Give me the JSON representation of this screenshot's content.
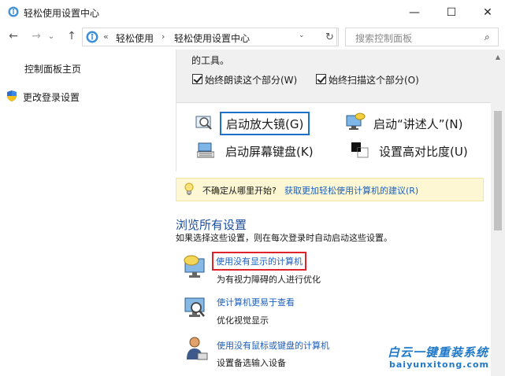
{
  "window": {
    "title": "轻松使用设置中心",
    "minimize": "—",
    "maximize": "☐",
    "close": "✕"
  },
  "nav": {
    "back": "←",
    "forward": "→",
    "recent": "⌄",
    "up": "↑",
    "address_chevron": "«",
    "breadcrumbs": [
      "轻松使用",
      "轻松使用设置中心"
    ],
    "crumb_separator": "›",
    "dropdown": "⌄",
    "refresh": "↻",
    "search_placeholder": "搜索控制面板",
    "search_icon": "⌕"
  },
  "leftnav": {
    "home": "控制面板主页",
    "login_settings": "更改登录设置"
  },
  "tools": {
    "intro": "的工具。",
    "checkbox_read": "始终朗读这个部分(W)",
    "checkbox_scan": "始终扫描这个部分(O)",
    "magnifier": "启动放大镜(G)",
    "narrator": "启动“讲述人”(N)",
    "keyboard": "启动屏幕键盘(K)",
    "high_contrast": "设置高对比度(U)"
  },
  "tip": {
    "text": "不确定从哪里开始?",
    "link": "获取更加轻松使用计算机的建议(R)"
  },
  "browse": {
    "title": "浏览所有设置",
    "description": "如果选择这些设置，则在每次登录时自动启动这些设置。",
    "items": [
      {
        "link": "使用没有显示的计算机",
        "sub": "为有视力障碍的人进行优化"
      },
      {
        "link": "使计算机更易于查看",
        "sub": "优化视觉显示"
      },
      {
        "link": "使用没有鼠标或键盘的计算机",
        "sub": "设置备选输入设备"
      }
    ]
  },
  "watermark": {
    "cn": "白云一键重装系统",
    "en": "baiyunxitong.com"
  },
  "colors": {
    "link": "#1c5fbd",
    "focus_border": "#1a72c9",
    "highlight_border": "#e0222a",
    "tip_bg": "#fdf8d3"
  }
}
